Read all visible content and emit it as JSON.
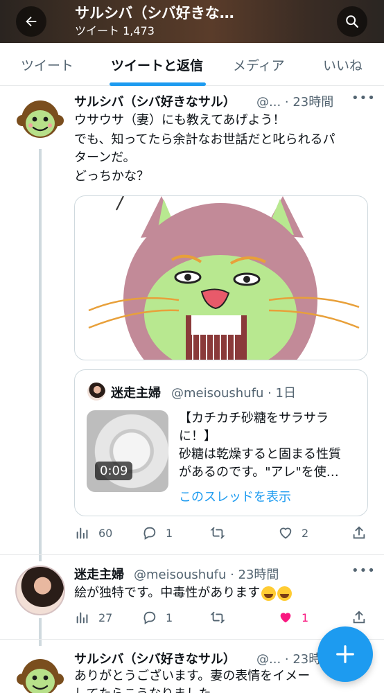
{
  "header": {
    "title": "サルシバ（シバ好きな…",
    "subtitle": "ツイート 1,473"
  },
  "tabs": [
    "ツイート",
    "ツイートと返信",
    "メディア",
    "いいね"
  ],
  "tweet1": {
    "name": "サルシバ（シバ好きなサル）",
    "meta": "@... · 23時間",
    "lines": [
      "ウサウサ（妻）にも教えてあげよう！",
      "でも、知ってたら余計なお世話だと叱られるパ",
      "ターンだ。",
      "どっちかな？"
    ],
    "quote": {
      "name": "迷走主婦",
      "meta": "@meisoushufu · 1日",
      "duration": "0:09",
      "lines": [
        "【カチカチ砂糖をサラサラ",
        "に！】",
        "砂糖は乾燥すると固まる性質",
        "があるのです。\"アレ\"を使…"
      ],
      "link": "このスレッドを表示"
    },
    "actions": {
      "views": "60",
      "replies": "1",
      "likes": "2"
    }
  },
  "tweet2": {
    "name": "迷走主婦",
    "meta": "@meisoushufu · 23時間",
    "text": "絵が独特です。中毒性があります",
    "actions": {
      "views": "27",
      "replies": "1",
      "likes": "1"
    }
  },
  "tweet3": {
    "name": "サルシバ（シバ好きなサル）",
    "meta": "@... · 23時間",
    "lines": [
      "ありがとうございます。妻の表情をイメー",
      "してたらこうなりました"
    ]
  },
  "colors": {
    "accent": "#1d9bf0",
    "like": "#f91880"
  }
}
